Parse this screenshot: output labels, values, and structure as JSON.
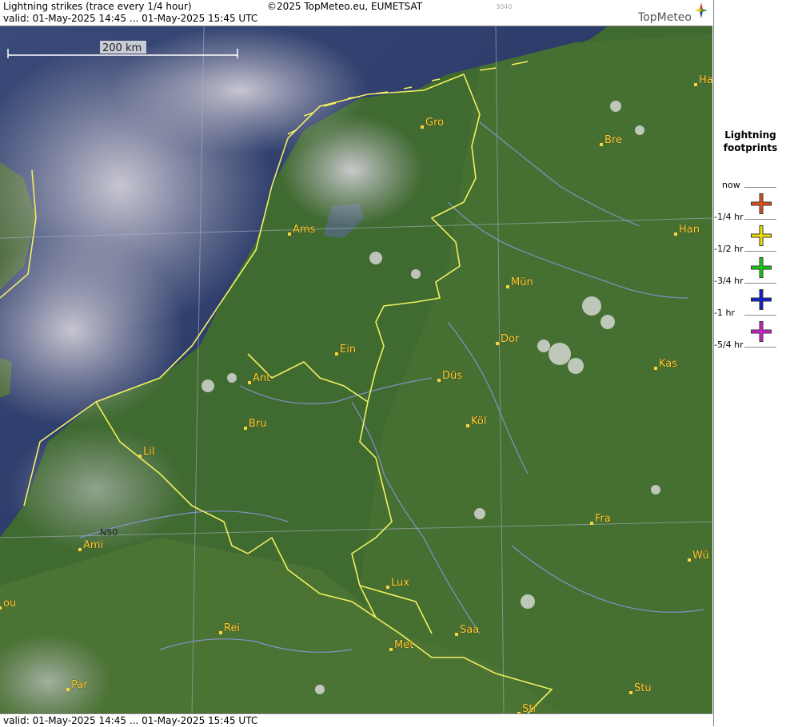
{
  "header": {
    "title": "Lightning strikes (trace every 1/4 hour)",
    "copyright": "©2025 TopMeteo.eu, EUMETSAT",
    "code": "3040",
    "valid": "valid:  01-May-2025 14:45 ... 01-May-2025 15:45 UTC",
    "logo": "TopMeteo"
  },
  "footer": {
    "valid": "valid:  01-May-2025 14:45 ... 01-May-2025 15:45 UTC"
  },
  "scale": {
    "label": "200 km"
  },
  "grid_label": "N50",
  "cities": [
    {
      "name": "Gro"
    },
    {
      "name": "Bre"
    },
    {
      "name": "Ha"
    },
    {
      "name": "Ams"
    },
    {
      "name": "Han"
    },
    {
      "name": "Mün"
    },
    {
      "name": "Dor"
    },
    {
      "name": "Ein"
    },
    {
      "name": "Kas"
    },
    {
      "name": "Ant"
    },
    {
      "name": "Düs"
    },
    {
      "name": "Bru"
    },
    {
      "name": "Köl"
    },
    {
      "name": "Lil"
    },
    {
      "name": "Fra"
    },
    {
      "name": "Ami"
    },
    {
      "name": "Wü"
    },
    {
      "name": "Lux"
    },
    {
      "name": "ou"
    },
    {
      "name": "Saa"
    },
    {
      "name": "Rei"
    },
    {
      "name": "Met"
    },
    {
      "name": "Par"
    },
    {
      "name": "Stu"
    },
    {
      "name": "Str"
    }
  ],
  "legend": {
    "title_line1": "Lightning",
    "title_line2": "footprints",
    "labels": [
      "now",
      "-1/4 hr",
      "-1/2 hr",
      "-3/4 hr",
      "-1 hr",
      "-5/4 hr"
    ],
    "colors": [
      "#e0501a",
      "#f0e000",
      "#10d010",
      "#1020d0",
      "#d020d0"
    ]
  }
}
